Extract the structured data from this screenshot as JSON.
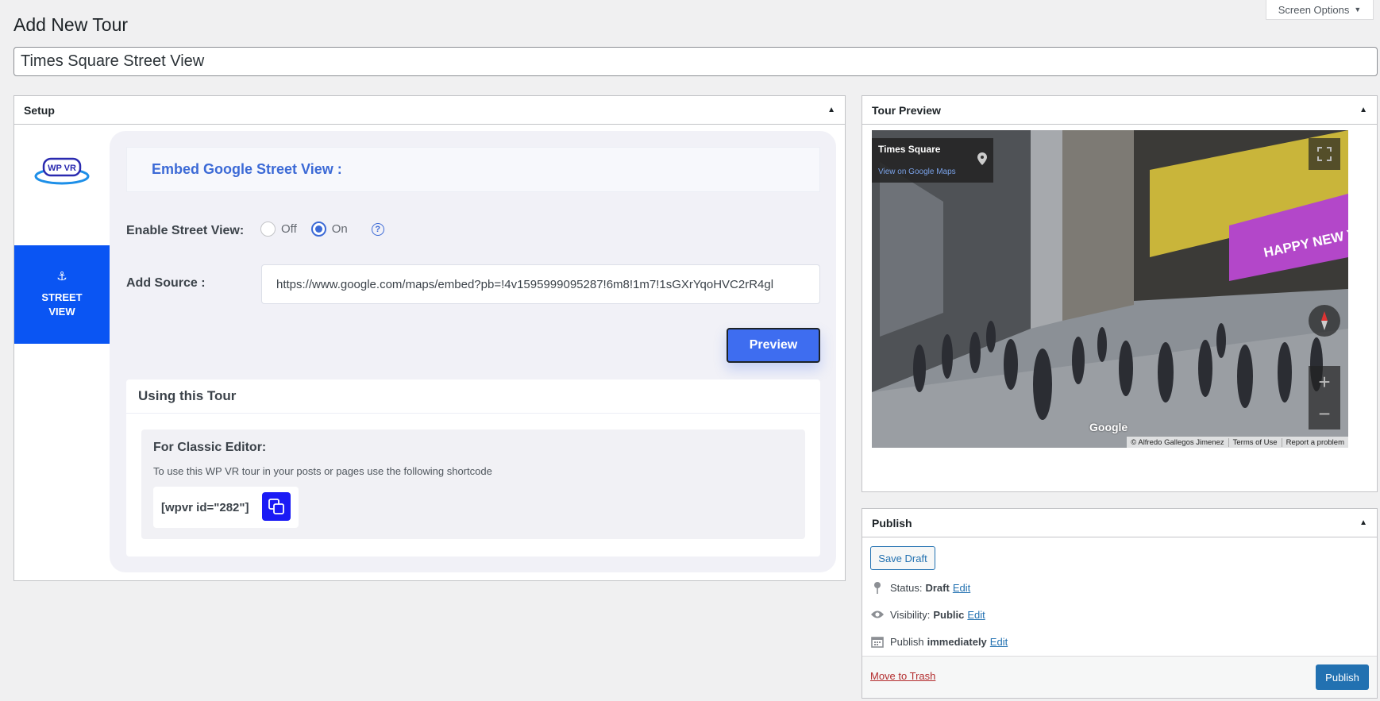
{
  "header": {
    "page_title": "Add New Tour",
    "screen_options": "Screen Options",
    "tour_title": "Times Square Street View"
  },
  "setup": {
    "title": "Setup",
    "logo_text": "WP VR",
    "nav_item": "STREET VIEW",
    "embed_heading": "Embed Google Street View :",
    "enable_label": "Enable Street View:",
    "radio_off": "Off",
    "radio_on": "On",
    "radio_selected": "On",
    "help_glyph": "?",
    "source_label": "Add Source :",
    "source_value": "https://www.google.com/maps/embed?pb=!4v1595999095287!6m8!1m7!1sGXrYqoHVC2rR4gl",
    "preview_button": "Preview",
    "using_title": "Using this Tour",
    "classic_title": "For Classic Editor:",
    "classic_desc": "To use this WP VR tour in your posts or pages use the following shortcode",
    "shortcode": "[wpvr id=\"282\"]"
  },
  "tour_preview": {
    "title": "Tour Preview",
    "place": "Times Square",
    "maps_link": "View on Google Maps",
    "google": "Google",
    "attribution": [
      "© Alfredo Gallegos Jimenez",
      "Terms of Use",
      "Report a problem"
    ],
    "zoom_in": "+",
    "zoom_out": "−"
  },
  "publish": {
    "title": "Publish",
    "save_draft": "Save Draft",
    "status_label": "Status:",
    "status_value": "Draft",
    "visibility_label": "Visibility:",
    "visibility_value": "Public",
    "publish_label": "Publish",
    "publish_value": "immediately",
    "edit": "Edit",
    "move_to_trash": "Move to Trash",
    "publish_button": "Publish"
  },
  "colors": {
    "accent": "#3c6ad6",
    "nav_active": "#0a55f3",
    "wp_primary": "#2271b1",
    "trash": "#b32d2e"
  }
}
